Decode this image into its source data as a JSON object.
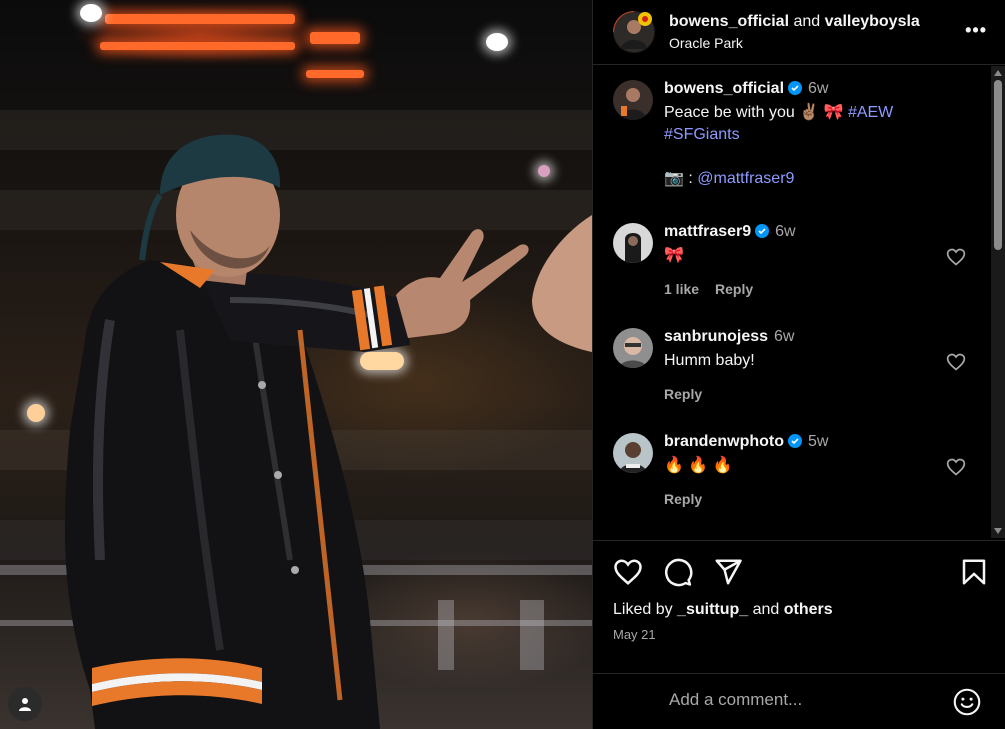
{
  "header": {
    "user1": "bowens_official",
    "conjunction": "and",
    "user2": "valleyboysla",
    "location": "Oracle Park",
    "more_icon": "more-horizontal-icon"
  },
  "caption": {
    "username": "bowens_official",
    "time": "6w",
    "text": "Peace be with you ✌🏽 🎀",
    "hashtag1": "#AEW",
    "hashtag2": "#SFGiants",
    "photo_credit_prefix": "📷 : ",
    "photo_credit": "@mattfraser9"
  },
  "comments": [
    {
      "username": "mattfraser9",
      "verified": true,
      "time": "6w",
      "text": "🎀",
      "likes": "1 like",
      "reply": "Reply"
    },
    {
      "username": "sanbrunojess",
      "verified": false,
      "time": "6w",
      "text": "Humm baby!",
      "reply": "Reply"
    },
    {
      "username": "brandenwphoto",
      "verified": true,
      "time": "5w",
      "text": "🔥 🔥 🔥",
      "reply": "Reply"
    }
  ],
  "actions": {
    "liked_by_prefix": "Liked by ",
    "liked_by_user": "_suittup_",
    "liked_by_mid": " and ",
    "liked_by_others": "others",
    "date": "May 21"
  },
  "comment_box": {
    "placeholder": "Add a comment..."
  },
  "colors": {
    "accent_link": "#8e9bff",
    "verified": "#0095f6",
    "muted": "#a8a8a8"
  }
}
